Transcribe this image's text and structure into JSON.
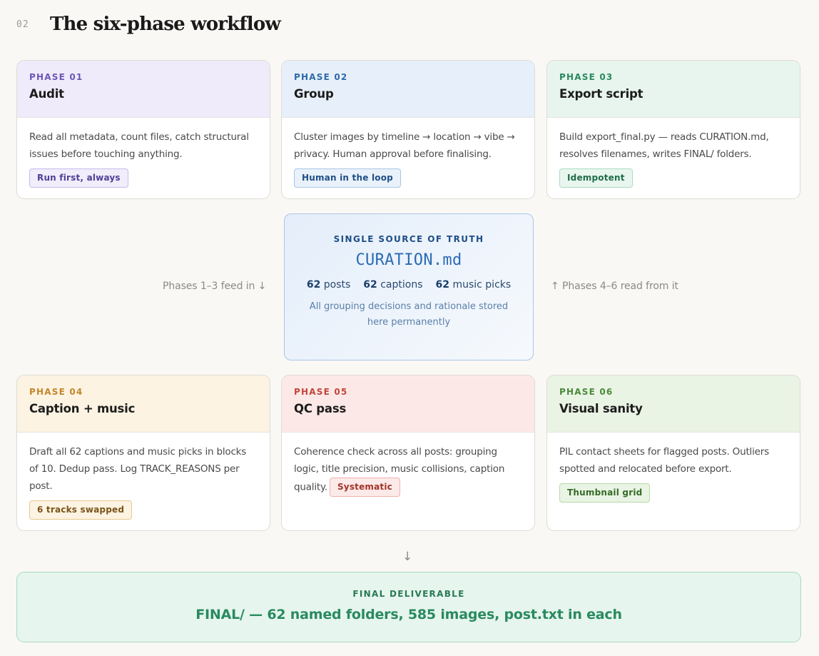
{
  "header": {
    "section_number": "02",
    "title": "The six-phase workflow"
  },
  "phases": [
    {
      "label": "PHASE 01",
      "title": "Audit",
      "description": "Read all metadata, count files, catch structural issues before touching anything.",
      "tag": "Run first, always"
    },
    {
      "label": "PHASE 02",
      "title": "Group",
      "description": "Cluster images by timeline → location → vibe → privacy. Human approval before finalising.",
      "tag": "Human in the loop"
    },
    {
      "label": "PHASE 03",
      "title": "Export script",
      "description": "Build export_final.py — reads CURATION.md, resolves filenames, writes FINAL/ folders.",
      "tag": "Idempotent"
    },
    {
      "label": "PHASE 04",
      "title": "Caption + music",
      "description": "Draft all 62 captions and music picks in blocks of 10. Dedup pass. Log TRACK_REASONS per post.",
      "tag": "6 tracks swapped"
    },
    {
      "label": "PHASE 05",
      "title": "QC pass",
      "description": "Coherence check across all posts: grouping logic, title precision, music collisions, caption quality.",
      "tag": "Systematic"
    },
    {
      "label": "PHASE 06",
      "title": "Visual sanity",
      "description": "PIL contact sheets for flagged posts. Outliers spotted and relocated before export.",
      "tag": "Thumbnail grid"
    }
  ],
  "source_of_truth": {
    "eyebrow": "SINGLE SOURCE OF TRUTH",
    "filename": "CURATION.md",
    "stats": [
      {
        "value": "62",
        "label": "posts"
      },
      {
        "value": "62",
        "label": "captions"
      },
      {
        "value": "62",
        "label": "music picks"
      }
    ],
    "note": "All grouping decisions and rationale stored here permanently"
  },
  "flow_notes": {
    "left": "Phases 1–3 feed in ↓",
    "right": "↑ Phases 4–6 read from it",
    "down_arrow": "↓"
  },
  "final": {
    "eyebrow": "FINAL DELIVERABLE",
    "text": "FINAL/ — 62 named folders, 585 images, post.txt in each"
  },
  "colors": {
    "phase01": "#6b57b8",
    "phase02": "#2f6aa8",
    "phase03": "#2a8a5e",
    "phase04": "#c4862c",
    "phase05": "#c2463b",
    "phase06": "#4a8a3a",
    "truth_accent": "#2a6bb4",
    "final_accent": "#2a8a5e"
  }
}
